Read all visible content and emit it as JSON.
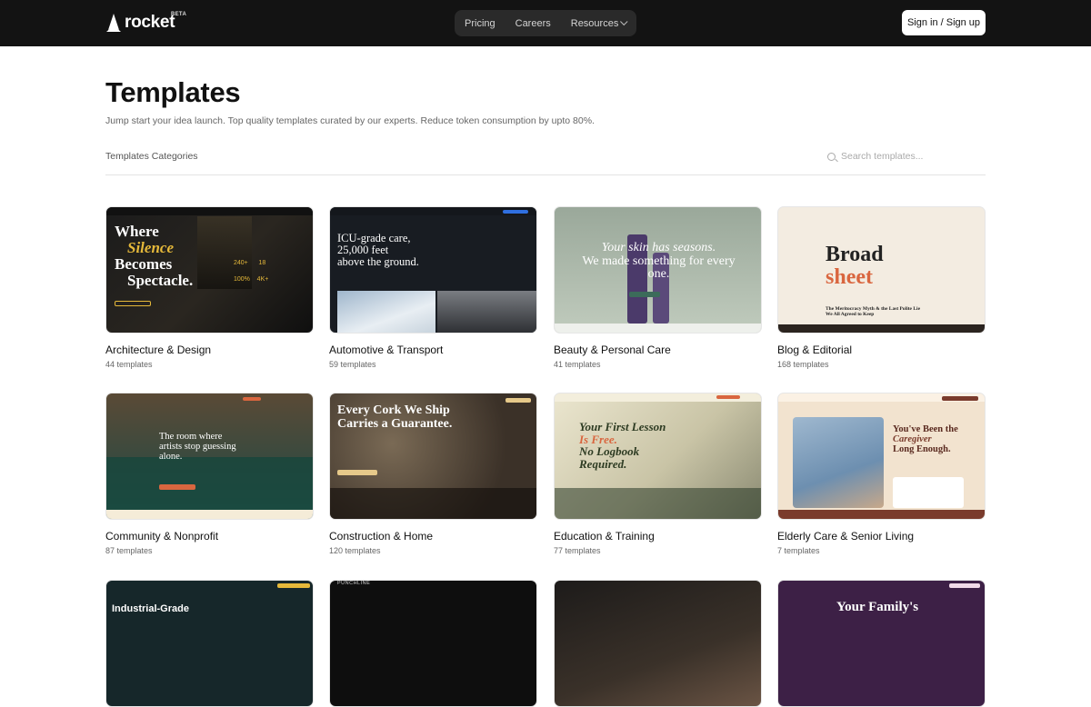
{
  "header": {
    "brand": "rocket",
    "beta": "BETA",
    "nav": [
      {
        "label": "Pricing"
      },
      {
        "label": "Careers"
      },
      {
        "label": "Resources"
      }
    ],
    "signin_label": "Sign in / Sign up"
  },
  "page": {
    "title": "Templates",
    "subtitle": "Jump start your idea launch. Top quality templates curated by our experts. Reduce token consumption by upto 80%.",
    "categories_label": "Templates Categories",
    "search_placeholder": "Search templates..."
  },
  "categories": [
    {
      "name": "Architecture & Design",
      "count": "44 templates",
      "thumb_text": [
        "Where",
        "Silence",
        "Becomes",
        "Spectacle."
      ]
    },
    {
      "name": "Automotive & Transport",
      "count": "59 templates",
      "thumb_text": [
        "ICU-grade care,",
        "25,000 feet",
        "above the ground."
      ]
    },
    {
      "name": "Beauty & Personal Care",
      "count": "41 templates",
      "thumb_text": [
        "Your skin has seasons.",
        "We made something for every",
        "one."
      ]
    },
    {
      "name": "Blog & Editorial",
      "count": "168 templates",
      "thumb_text": [
        "Broad",
        "sheet",
        "The Meritocracy Myth & the Last Polite Lie",
        "We All Agreed to Keep"
      ]
    },
    {
      "name": "Community & Nonprofit",
      "count": "87 templates",
      "thumb_text": [
        "The room where",
        "artists stop guessing",
        "alone."
      ]
    },
    {
      "name": "Construction & Home",
      "count": "120 templates",
      "thumb_text": [
        "Every Cork We Ship",
        "Carries a Guarantee."
      ]
    },
    {
      "name": "Education & Training",
      "count": "77 templates",
      "thumb_text": [
        "Your First Lesson",
        "Is Free.",
        "No Logbook",
        "Required."
      ]
    },
    {
      "name": "Elderly Care & Senior Living",
      "count": "7 templates",
      "thumb_text": [
        "You've Been the",
        "Caregiver",
        "Long Enough."
      ]
    },
    {
      "name": "",
      "count": "",
      "thumb_text": [
        "Industrial-Grade"
      ]
    },
    {
      "name": "",
      "count": "",
      "thumb_text": [
        "PUNCHLINE"
      ]
    },
    {
      "name": "",
      "count": "",
      "thumb_text": []
    },
    {
      "name": "",
      "count": "",
      "thumb_text": [
        "Your Family's"
      ]
    }
  ],
  "colors": {
    "topbar": "#131313",
    "nav_bg": "#2a2a2a",
    "accent_gold": "#e6b93a",
    "accent_coral": "#d9663f"
  }
}
